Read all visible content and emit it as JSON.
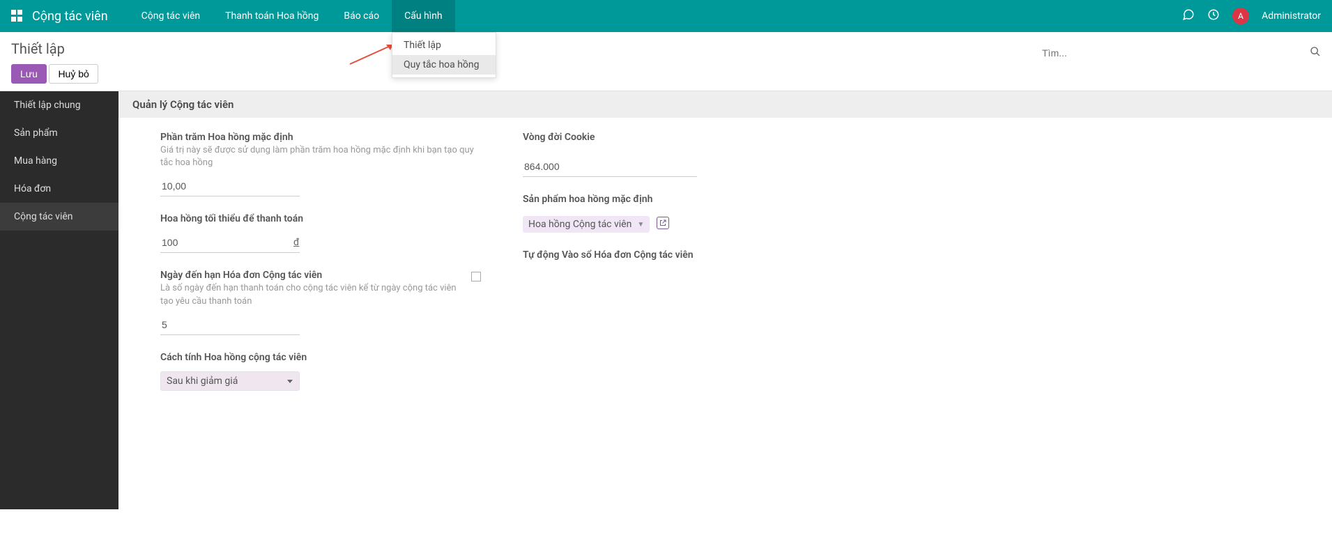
{
  "topbar": {
    "app_title": "Cộng tác viên",
    "nav": [
      {
        "label": "Cộng tác viên"
      },
      {
        "label": "Thanh toán Hoa hồng"
      },
      {
        "label": "Báo cáo"
      },
      {
        "label": "Cấu hình"
      }
    ],
    "user": {
      "initial": "A",
      "name": "Administrator"
    }
  },
  "dropdown": {
    "items": [
      {
        "label": "Thiết lập"
      },
      {
        "label": "Quy tắc hoa hồng"
      }
    ]
  },
  "control_panel": {
    "title": "Thiết lập",
    "save_label": "Lưu",
    "discard_label": "Huỷ bỏ",
    "search_placeholder": "Tìm..."
  },
  "sidebar": {
    "items": [
      {
        "label": "Thiết lập chung"
      },
      {
        "label": "Sản phẩm"
      },
      {
        "label": "Mua hàng"
      },
      {
        "label": "Hóa đơn"
      },
      {
        "label": "Cộng tác viên"
      }
    ]
  },
  "section": {
    "header": "Quản lý Cộng tác viên"
  },
  "fields": {
    "default_commission_pct": {
      "label": "Phần trăm Hoa hồng mặc định",
      "help": "Giá trị này sẽ được sử dụng làm phần trăm hoa hồng mặc định khi bạn tạo quy tắc hoa hồng",
      "value": "10,00"
    },
    "min_commission": {
      "label": "Hoa hồng tối thiểu để thanh toán",
      "value": "100",
      "currency": "đ"
    },
    "invoice_due_days": {
      "label": "Ngày đến hạn Hóa đơn Cộng tác viên",
      "help": "Là số ngày đến hạn thanh toán cho cộng tác viên kể từ ngày cộng tác viên tạo yêu cầu thanh toán",
      "value": "5"
    },
    "commission_calc": {
      "label": "Cách tính Hoa hồng cộng tác viên",
      "value": "Sau khi giảm giá"
    },
    "cookie_lifetime": {
      "label": "Vòng đời Cookie",
      "value": "864.000"
    },
    "default_commission_product": {
      "label": "Sản phẩm hoa hồng mặc định",
      "value": "Hoa hồng Cộng tác viên"
    },
    "auto_post_invoice": {
      "label": "Tự động Vào sổ Hóa đơn Cộng tác viên"
    }
  }
}
